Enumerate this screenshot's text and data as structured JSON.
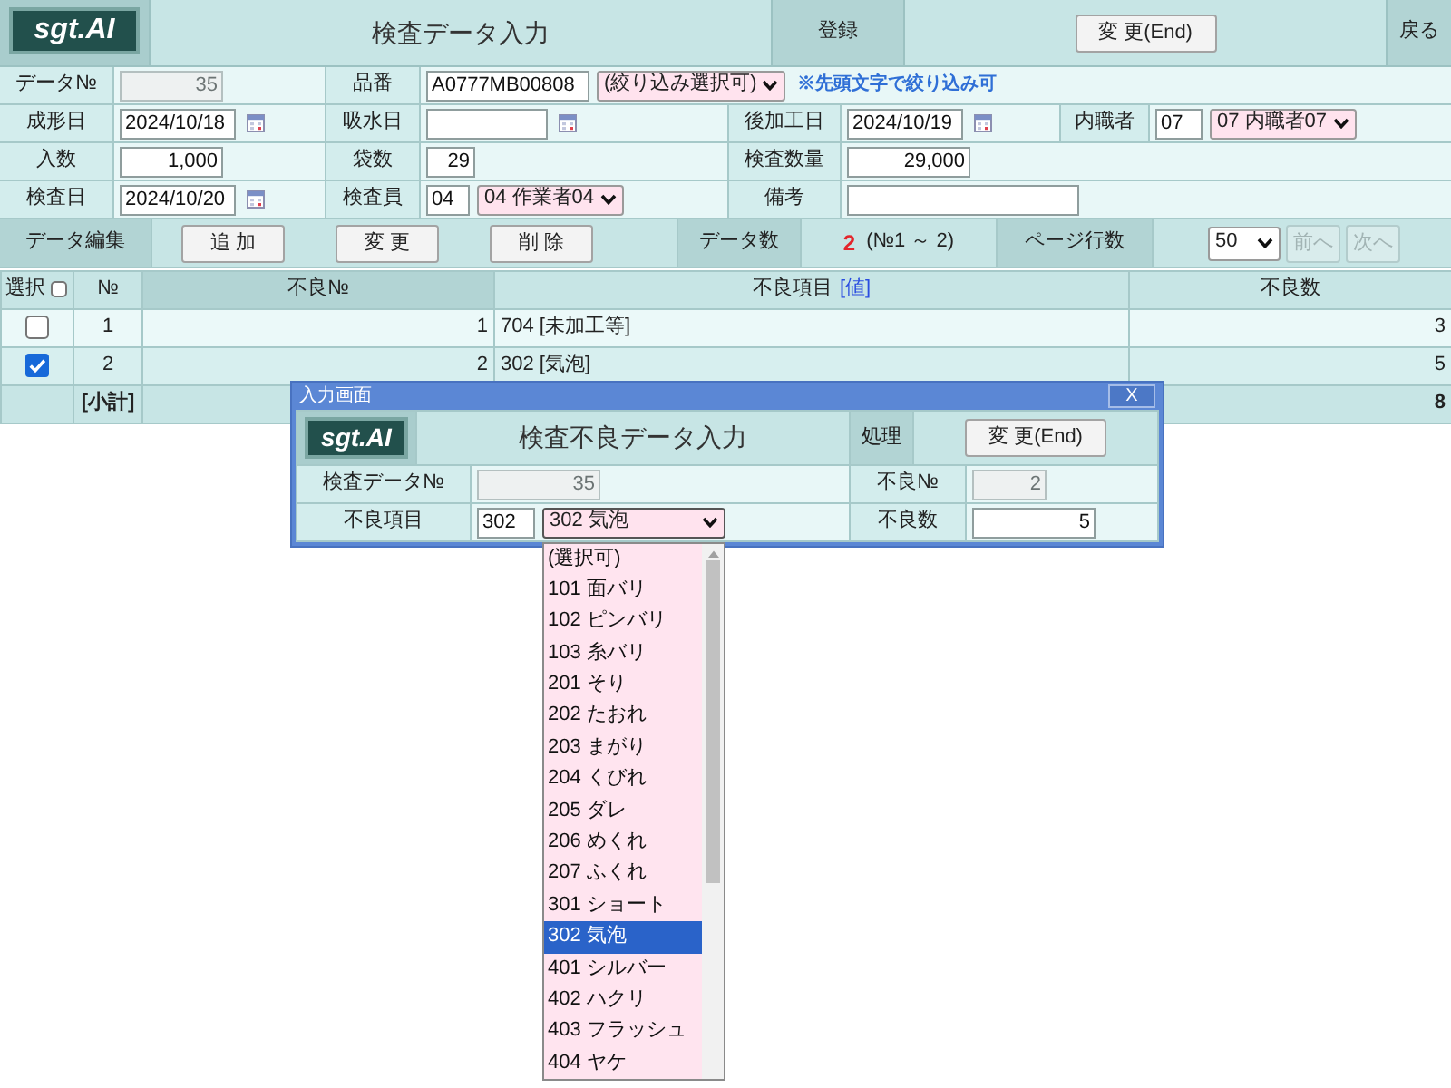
{
  "header": {
    "logo": "sgt.AI",
    "title": "検査データ入力",
    "section_label": "登録",
    "change_button": "変 更(End)",
    "back_button": "戻る"
  },
  "form": [
    [
      {
        "label": "データ№",
        "fields": [
          {
            "kind": "number",
            "value": "35",
            "disabled": true
          }
        ]
      },
      {
        "label": "品番",
        "fields": [
          {
            "kind": "text",
            "value": "A0777MB00808",
            "disabled": false
          },
          {
            "kind": "select",
            "value": "(絞り込み選択可)",
            "expanded": false
          },
          {
            "kind": "note",
            "text": "※先頭文字で絞り込み可"
          }
        ]
      }
    ],
    [
      {
        "label": "成形日",
        "fields": [
          {
            "kind": "date",
            "value": "2024/10/18",
            "disabled": false
          }
        ]
      },
      {
        "label": "吸水日",
        "fields": [
          {
            "kind": "date",
            "disabled": false
          }
        ]
      },
      {
        "label": "後加工日",
        "fields": [
          {
            "kind": "date",
            "value": "2024/10/19",
            "disabled": false
          }
        ]
      },
      {
        "label": "内職者",
        "fields": [
          {
            "kind": "text",
            "value": "07",
            "disabled": false
          },
          {
            "kind": "select",
            "value": "07 内職者07",
            "expanded": false
          }
        ]
      }
    ],
    [
      {
        "label": "入数",
        "fields": [
          {
            "kind": "number",
            "value": "1,000",
            "disabled": false
          }
        ]
      },
      {
        "label": "袋数",
        "fields": [
          {
            "kind": "number",
            "value": "29",
            "disabled": false
          }
        ]
      },
      {
        "label": "検査数量",
        "fields": [
          {
            "kind": "number",
            "value": "29,000",
            "disabled": false
          }
        ]
      }
    ],
    [
      {
        "label": "検査日",
        "fields": [
          {
            "kind": "date",
            "value": "2024/10/20",
            "disabled": false
          }
        ]
      },
      {
        "label": "検査員",
        "fields": [
          {
            "kind": "text",
            "value": "04",
            "disabled": false
          },
          {
            "kind": "select",
            "value": "04 作業者04",
            "expanded": false
          }
        ]
      },
      {
        "label": "備考",
        "fields": [
          {
            "kind": "text",
            "disabled": false
          }
        ]
      }
    ]
  ],
  "toolbar": {
    "label": "データ編集",
    "buttons": [
      "追 加",
      "変 更",
      "削 除"
    ],
    "count_label": "データ数",
    "count": "2",
    "range": "(№1 ～ 2)",
    "page_size_label": "ページ行数",
    "page_size": "50",
    "pager": [
      {
        "label": "前へ",
        "disabled": true
      },
      {
        "label": "次へ",
        "disabled": true
      }
    ]
  },
  "table": {
    "columns": [
      {
        "label": "選択",
        "highlighted": false,
        "checkbox": {
          "checked": false
        }
      },
      {
        "label": "№",
        "highlighted": false
      },
      {
        "label": "不良№",
        "highlighted": true
      },
      {
        "label": "不良項目",
        "link": "[値]",
        "highlighted": false
      },
      {
        "label": "不良数",
        "highlighted": false
      }
    ],
    "rows": [
      {
        "cells": [
          {
            "checked": false
          },
          "1",
          "1",
          "704 [未加工等]",
          "3"
        ]
      },
      {
        "cells": [
          {
            "checked": true
          },
          "2",
          "2",
          "302 [気泡]",
          "5"
        ]
      }
    ],
    "subtotal": {
      "label": "[小計]",
      "total": "8"
    }
  },
  "dialog": {
    "title": "入力画面",
    "close": "X",
    "logo": "sgt.AI",
    "heading": "検査不良データ入力",
    "section_label": "処理",
    "change_button": "変 更(End)",
    "rows": [
      [
        {
          "label": "検査データ№",
          "fields": [
            {
              "kind": "number",
              "value": "35",
              "disabled": true
            }
          ]
        },
        {
          "label": "不良№",
          "fields": [
            {
              "kind": "number",
              "value": "2",
              "disabled": true
            }
          ]
        }
      ],
      [
        {
          "label": "不良項目",
          "fields": [
            {
              "kind": "text",
              "value": "302",
              "disabled": false
            },
            {
              "kind": "select",
              "value": "302 気泡",
              "expanded": true,
              "options": [
                {
                  "label": "(選択可)",
                  "selected": false
                },
                {
                  "label": "101 面バリ",
                  "selected": false
                },
                {
                  "label": "102 ピンバリ",
                  "selected": false
                },
                {
                  "label": "103 糸バリ",
                  "selected": false
                },
                {
                  "label": "201 そり",
                  "selected": false
                },
                {
                  "label": "202 たおれ",
                  "selected": false
                },
                {
                  "label": "203 まがり",
                  "selected": false
                },
                {
                  "label": "204 くびれ",
                  "selected": false
                },
                {
                  "label": "205 ダレ",
                  "selected": false
                },
                {
                  "label": "206 めくれ",
                  "selected": false
                },
                {
                  "label": "207 ふくれ",
                  "selected": false
                },
                {
                  "label": "301 ショート",
                  "selected": false
                },
                {
                  "label": "302 気泡",
                  "selected": true
                },
                {
                  "label": "401 シルバー",
                  "selected": false
                },
                {
                  "label": "402 ハクリ",
                  "selected": false
                },
                {
                  "label": "403 フラッシュ",
                  "selected": false
                },
                {
                  "label": "404 ヤケ",
                  "selected": false
                }
              ]
            }
          ]
        },
        {
          "label": "不良数",
          "fields": [
            {
              "kind": "number",
              "value": "5",
              "disabled": false
            }
          ]
        }
      ]
    ]
  }
}
